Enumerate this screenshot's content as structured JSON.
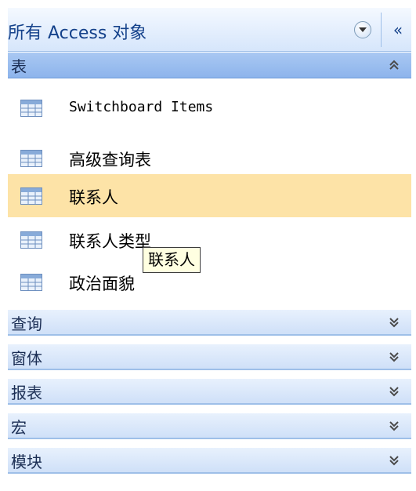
{
  "header": {
    "title": "所有 Access 对象",
    "menu_icon": "chevron-down-circle-icon",
    "collapse_icon": "double-chevron-left-icon",
    "collapse_glyph": "«"
  },
  "groups": [
    {
      "label": "表",
      "state": "expanded"
    },
    {
      "label": "查询",
      "state": "collapsed"
    },
    {
      "label": "窗体",
      "state": "collapsed"
    },
    {
      "label": "报表",
      "state": "collapsed"
    },
    {
      "label": "宏",
      "state": "collapsed"
    },
    {
      "label": "模块",
      "state": "collapsed"
    }
  ],
  "tables": [
    {
      "label": "Switchboard Items",
      "icon": "table-icon"
    },
    {
      "label": "高级查询表",
      "icon": "table-icon"
    },
    {
      "label": "联系人",
      "icon": "table-icon",
      "selected": true
    },
    {
      "label": "联系人类型",
      "icon": "table-icon"
    },
    {
      "label": "政治面貌",
      "icon": "table-icon"
    }
  ],
  "tooltip": {
    "text": "联系人"
  },
  "colors": {
    "header_bg": "#e5effd",
    "active_group_bg": "#9bbdf0",
    "group_bg": "#dbe8fa",
    "selected_item_bg": "#fde3a7",
    "tooltip_bg": "#ffffe1"
  }
}
